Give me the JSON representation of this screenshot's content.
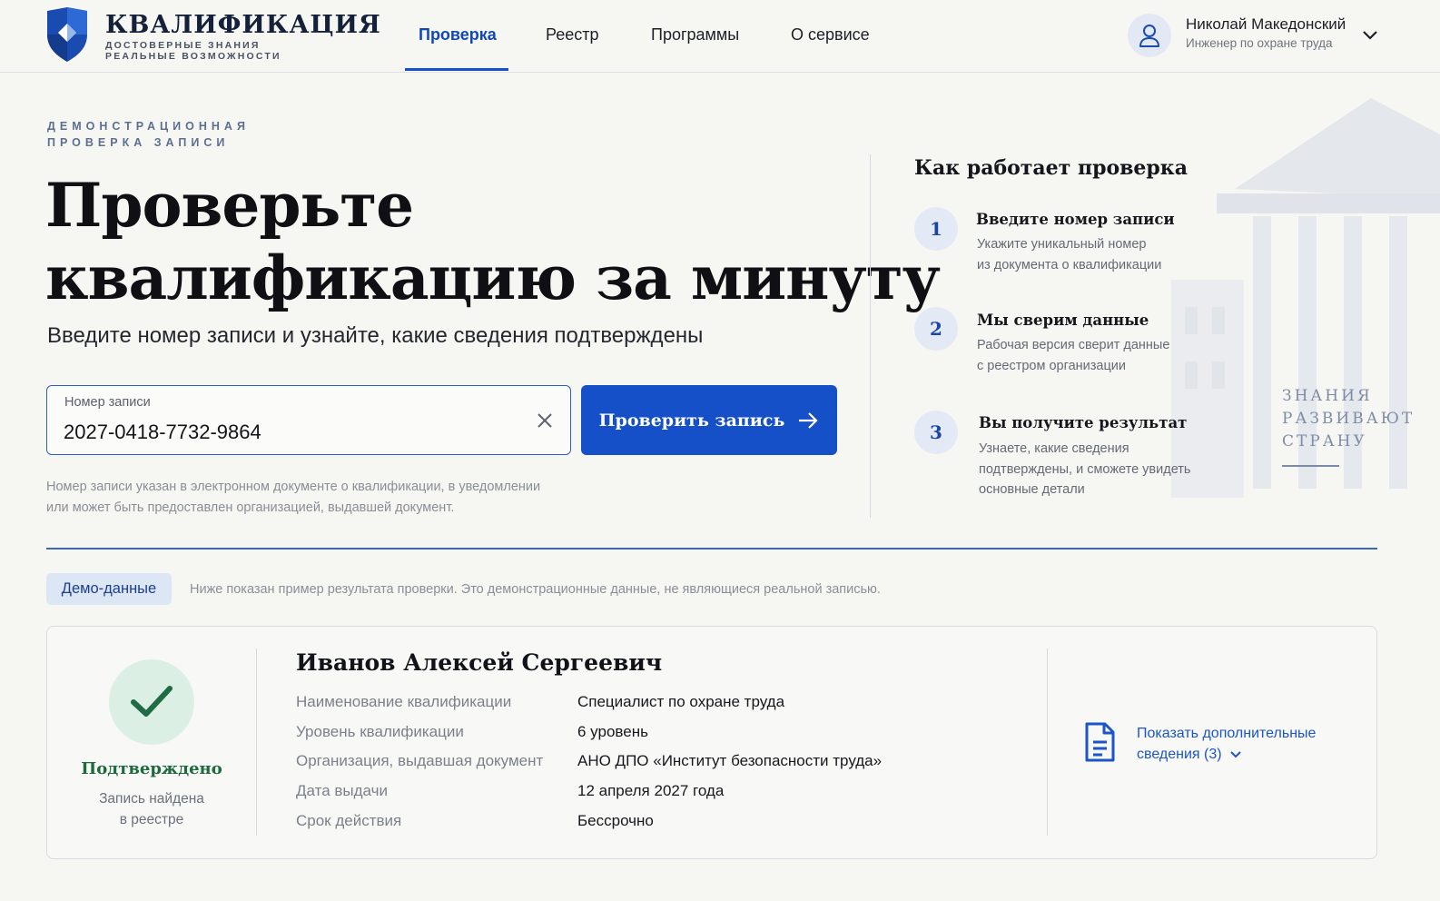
{
  "header": {
    "logo_title": "КВАЛИФИКАЦИЯ",
    "logo_sub_1": "ДОСТОВЕРНЫЕ ЗНАНИЯ",
    "logo_sub_2": "РЕАЛЬНЫЕ ВОЗМОЖНОСТИ",
    "nav": [
      "Проверка",
      "Реестр",
      "Программы",
      "О сервисе"
    ],
    "active_nav": "Проверка",
    "user_name": "Николай Македонский",
    "user_role": "Инженер по охране труда"
  },
  "hero": {
    "eyebrow_1": "ДЕМОНСТРАЦИОННАЯ",
    "eyebrow_2": "ПРОВЕРКА ЗАПИСИ",
    "title_1": "Проверьте",
    "title_2": "квалификацию за минуту",
    "subtitle": "Введите номер записи и узнайте, какие сведения подтверждены"
  },
  "search": {
    "label": "Номер записи",
    "value": "2027-0418-7732-9864",
    "button": "Проверить запись",
    "hint_1": "Номер записи указан в электронном документе о квалификации, в уведомлении",
    "hint_2": "или может быть предоставлен организацией, выдавшей документ."
  },
  "how": {
    "title": "Как работает проверка",
    "steps": [
      {
        "num": "1",
        "title": "Введите номер записи",
        "text_1": "Укажите уникальный номер",
        "text_2": "из документа о квалификации",
        "text_3": ""
      },
      {
        "num": "2",
        "title": "Мы сверим данные",
        "text_1": "Рабочая версия сверит данные",
        "text_2": "с реестром организации",
        "text_3": ""
      },
      {
        "num": "3",
        "title": "Вы получите результат",
        "text_1": "Узнаете, какие сведения",
        "text_2": "подтверждены, и сможете увидеть",
        "text_3": "основные детали"
      }
    ]
  },
  "motto": [
    "ЗНАНИЯ",
    "РАЗВИВАЮТ",
    "СТРАНУ"
  ],
  "demo": {
    "badge": "Демо-данные",
    "note": "Ниже показан пример результата проверки. Это демонстрационные данные, не являющиеся реальной записью."
  },
  "result": {
    "status": "Подтверждено",
    "status_sub_1": "Запись найдена",
    "status_sub_2": "в реестре",
    "name": "Иванов Алексей Сергеевич",
    "fields": [
      {
        "label": "Наименование квалификации",
        "value": "Специалист по охране труда"
      },
      {
        "label": "Уровень квалификации",
        "value": "6 уровень"
      },
      {
        "label": "Организация, выдавшая документ",
        "value": "АНО ДПО «Институт безопасности труда»"
      },
      {
        "label": "Дата выдачи",
        "value": "12 апреля 2027 года"
      },
      {
        "label": "Срок действия",
        "value": "Бессрочно"
      }
    ],
    "more_1": "Показать дополнительные",
    "more_2": "сведения (3)"
  },
  "colors": {
    "accent": "#1550c9",
    "success": "#1d6a3f",
    "background": "#f6f6f3"
  }
}
